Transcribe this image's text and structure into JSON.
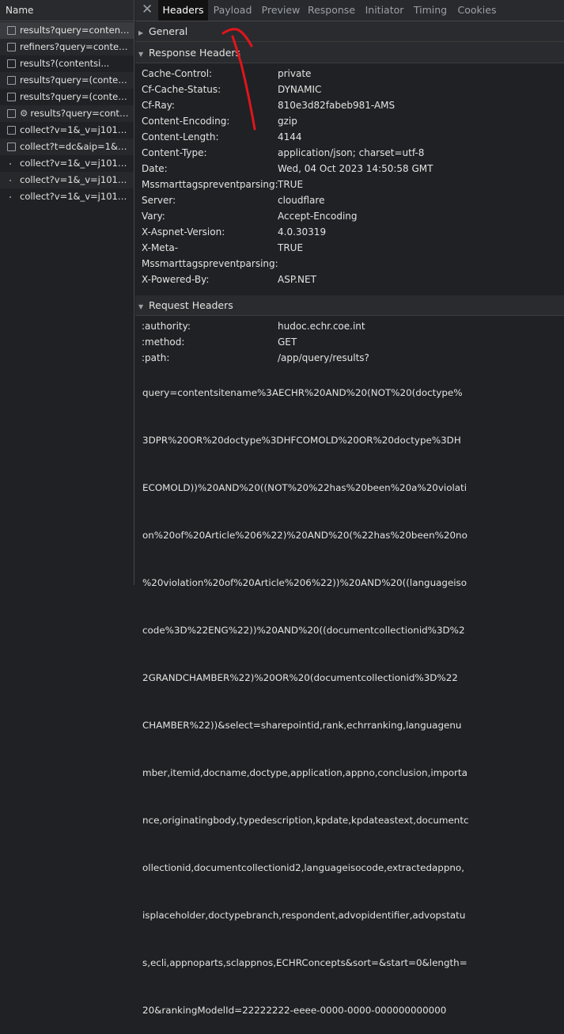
{
  "request_list": {
    "column_title": "Name",
    "items": [
      {
        "name": "results?query=contentsit...",
        "icon": "checkbox"
      },
      {
        "name": "refiners?query=contents...",
        "icon": "checkbox"
      },
      {
        "name": "results?(contentsi...",
        "icon": "checkbox"
      },
      {
        "name": "results?query=(contentsi...",
        "icon": "checkbox"
      },
      {
        "name": "results?query=(contentsi...",
        "icon": "checkbox"
      },
      {
        "name": "results?query=conten...",
        "icon": "checkbox",
        "gear": "⚙"
      },
      {
        "name": "collect?v=1&_v=j101&a...",
        "icon": "checkbox"
      },
      {
        "name": "collect?t=dc&aip=1&_r...",
        "icon": "checkbox"
      },
      {
        "name": "collect?v=1&_v=j101&a...",
        "icon": "dot"
      },
      {
        "name": "collect?v=1&_v=j101&a...",
        "icon": "dot"
      },
      {
        "name": "collect?v=1&_v=j101&a...",
        "icon": "dot"
      }
    ]
  },
  "tabs": {
    "close_symbol": "✕",
    "items": [
      "Headers",
      "Payload",
      "Preview",
      "Response",
      "Initiator",
      "Timing",
      "Cookies"
    ],
    "active": "Headers"
  },
  "sections": {
    "general": {
      "title": "General",
      "arrow": "▶"
    },
    "response": {
      "title": "Response Headers",
      "arrow": "▼"
    },
    "request": {
      "title": "Request Headers",
      "arrow": "▼"
    }
  },
  "response_headers": [
    {
      "key": "Cache-Control:",
      "value": "private"
    },
    {
      "key": "Cf-Cache-Status:",
      "value": "DYNAMIC"
    },
    {
      "key": "Cf-Ray:",
      "value": "810e3d82fabeb981-AMS"
    },
    {
      "key": "Content-Encoding:",
      "value": "gzip"
    },
    {
      "key": "Content-Length:",
      "value": "4144"
    },
    {
      "key": "Content-Type:",
      "value": "application/json; charset=utf-8"
    },
    {
      "key": "Date:",
      "value": "Wed, 04 Oct 2023 14:50:58 GMT"
    },
    {
      "key": "Mssmarttagspreventparsing:",
      "value": "TRUE"
    },
    {
      "key": "Server:",
      "value": "cloudflare"
    },
    {
      "key": "Vary:",
      "value": "Accept-Encoding"
    },
    {
      "key": "X-Aspnet-Version:",
      "value": "4.0.30319"
    },
    {
      "key": "X-Meta-\nMssmarttagspreventparsing:",
      "value": "TRUE"
    },
    {
      "key": "X-Powered-By:",
      "value": "ASP.NET"
    }
  ],
  "request_headers": [
    {
      "key": ":authority:",
      "value": "hudoc.echr.coe.int"
    },
    {
      "key": ":method:",
      "value": "GET"
    },
    {
      "key": ":path:",
      "value": "/app/query/results?"
    }
  ],
  "path_continuation": [
    "query=contentsitename%3AECHR%20AND%20(NOT%20(doctype%",
    "3DPR%20OR%20doctype%3DHFCOMOLD%20OR%20doctype%3DH",
    "ECOMOLD))%20AND%20((NOT%20%22has%20been%20a%20violati",
    "on%20of%20Article%206%22)%20AND%20(%22has%20been%20no",
    "%20violation%20of%20Article%206%22))%20AND%20((languageiso",
    "code%3D%22ENG%22))%20AND%20((documentcollectionid%3D%2",
    "2GRANDCHAMBER%22)%20OR%20(documentcollectionid%3D%22",
    "CHAMBER%22))&select=sharepointid,rank,echrranking,languagenu",
    "mber,itemid,docname,doctype,application,appno,conclusion,importa",
    "nce,originatingbody,typedescription,kpdate,kpdateastext,documentc",
    "ollectionid,documentcollectionid2,languageisocode,extractedappno,",
    "isplaceholder,doctypebranch,respondent,advopidentifier,advopstatu",
    "s,ecli,appnoparts,sclappnos,ECHRConcepts&sort=&start=0&length=",
    "20&rankingModelId=22222222-eeee-0000-0000-000000000000"
  ],
  "colors": {
    "background": "#202124",
    "active_tab_bg": "#121212",
    "annotation": "#e0151c"
  }
}
